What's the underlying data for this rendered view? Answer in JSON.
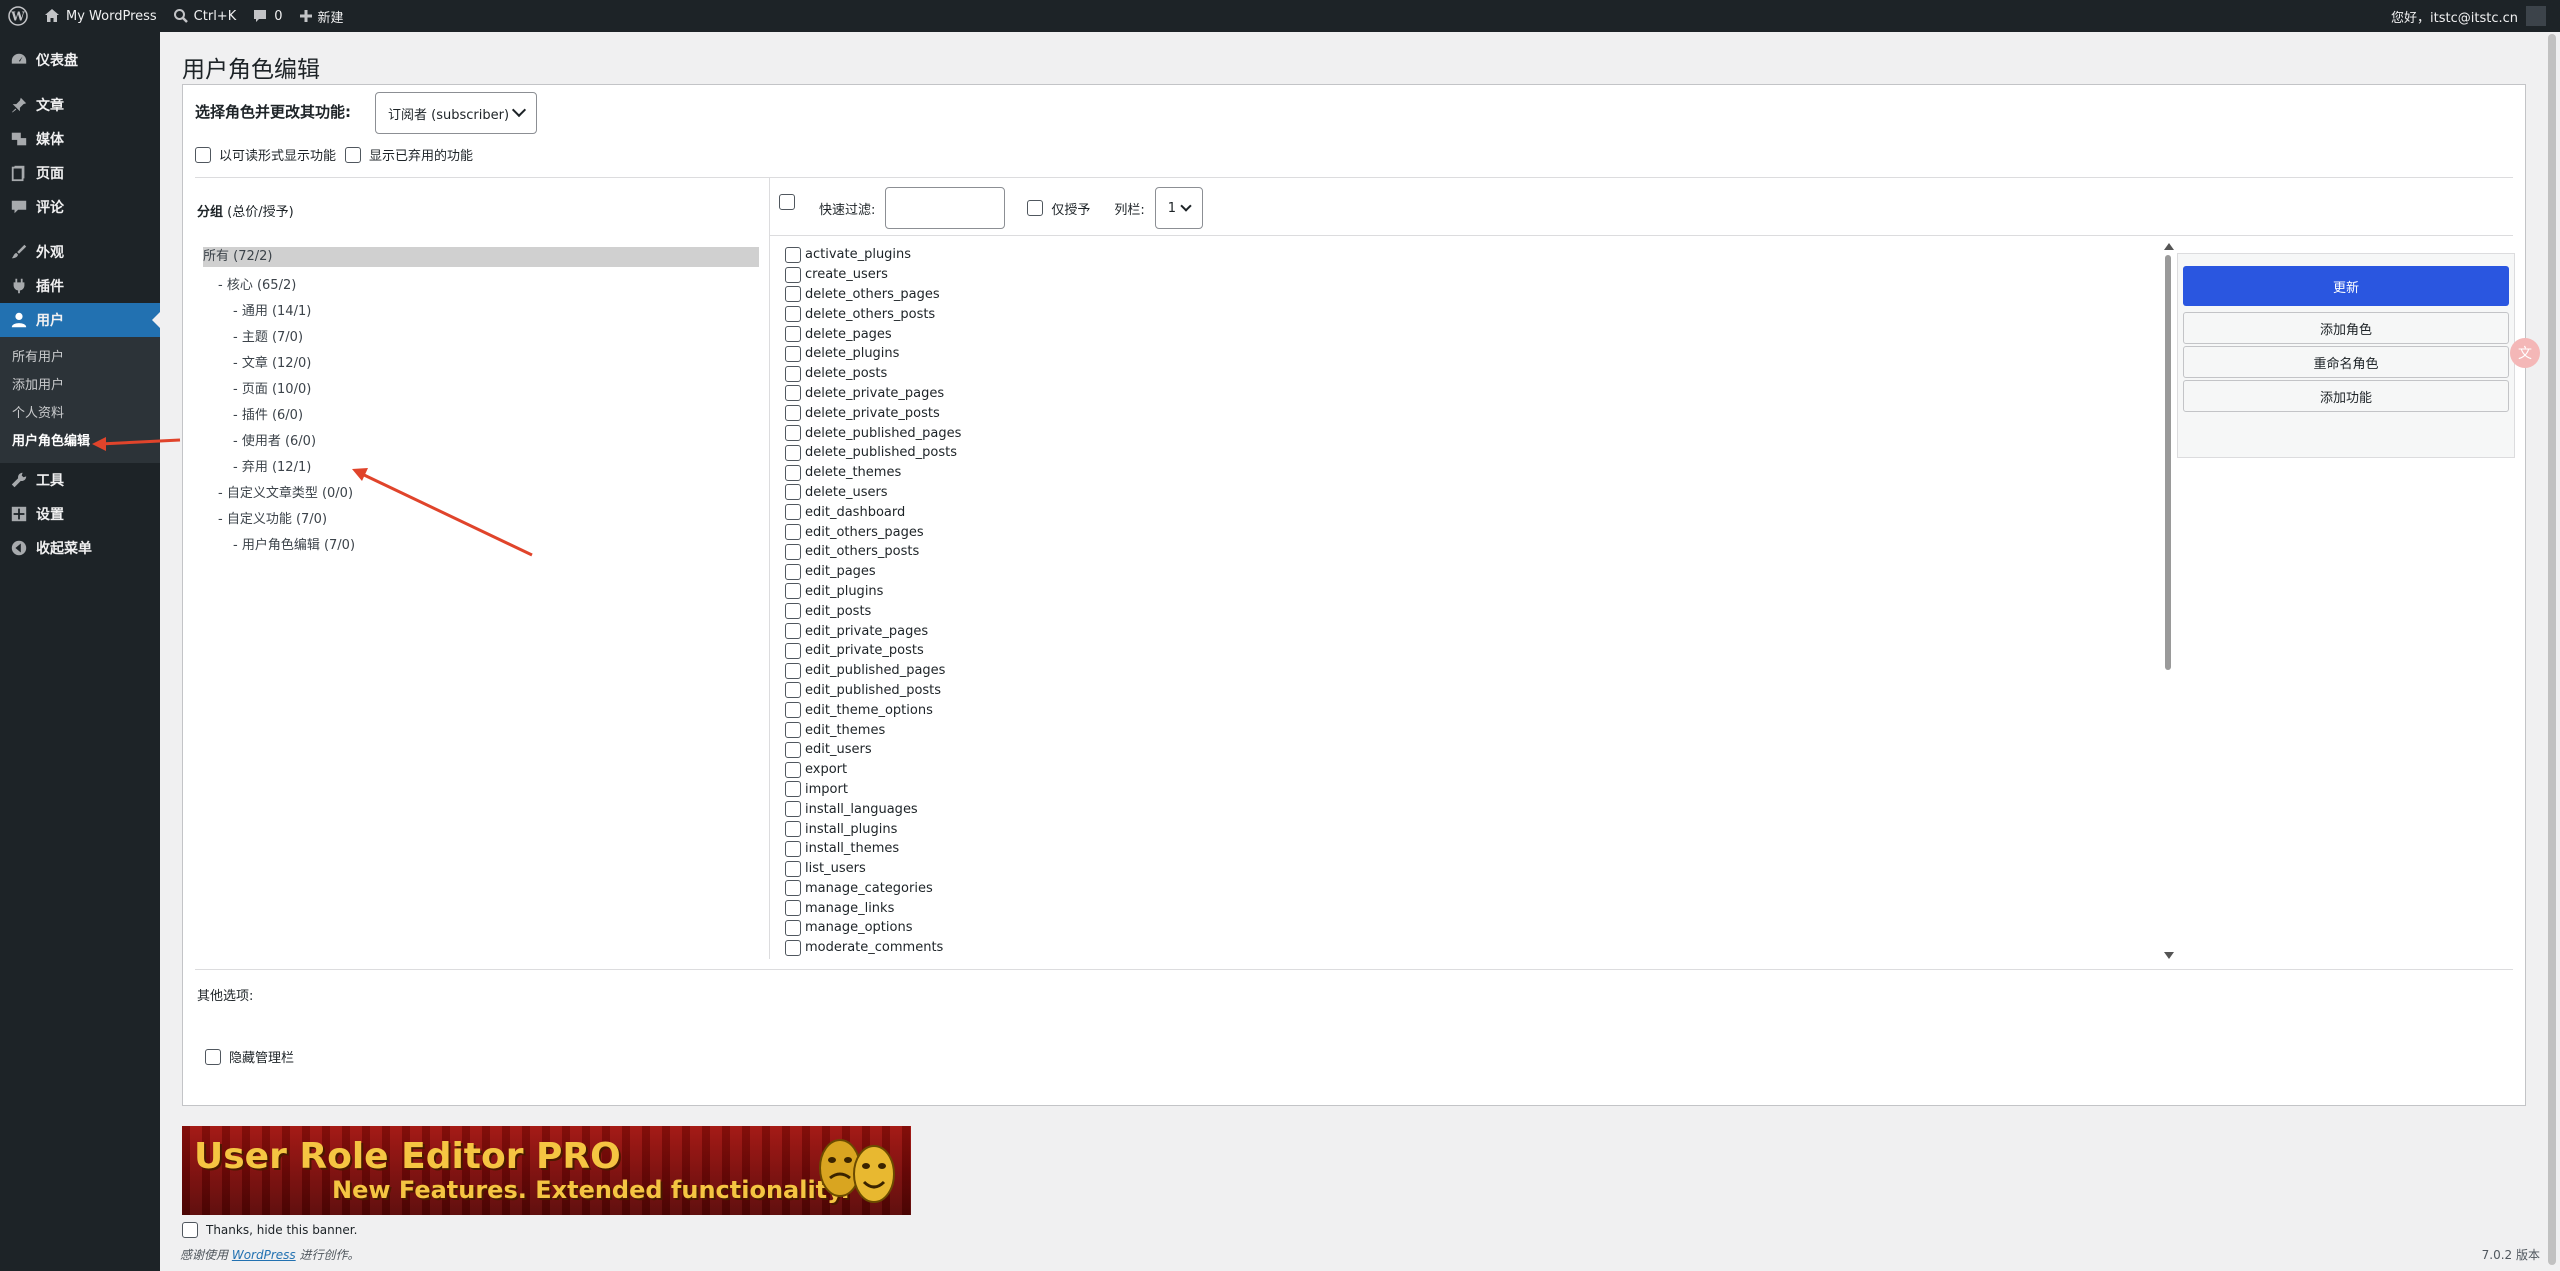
{
  "adminbar": {
    "site_name": "My WordPress",
    "search_shortcut": "Ctrl+K",
    "comments_count": "0",
    "new_label": "新建",
    "greeting": "您好，itstc@itstc.cn"
  },
  "sidebar": {
    "items": [
      {
        "label": "仪表盘",
        "icon": "dashboard-icon"
      },
      {
        "label": "文章",
        "icon": "pin-icon"
      },
      {
        "label": "媒体",
        "icon": "media-icon"
      },
      {
        "label": "页面",
        "icon": "page-icon"
      },
      {
        "label": "评论",
        "icon": "comment-icon"
      },
      {
        "label": "外观",
        "icon": "brush-icon"
      },
      {
        "label": "插件",
        "icon": "plugin-icon"
      },
      {
        "label": "用户",
        "icon": "user-icon"
      },
      {
        "label": "工具",
        "icon": "wrench-icon"
      },
      {
        "label": "设置",
        "icon": "settings-icon"
      },
      {
        "label": "收起菜单",
        "icon": "collapse-icon"
      }
    ],
    "submenu": [
      "所有用户",
      "添加用户",
      "个人资料",
      "用户角色编辑"
    ]
  },
  "page": {
    "title": "用户角色编辑",
    "role_label": "选择角色并更改其功能:",
    "role_value": "订阅者 (subscriber)",
    "opt_readable": "以可读形式显示功能",
    "opt_deprecated": "显示已弃用的功能",
    "groups_head_bold": "分组",
    "groups_head_rest": " (总价/授予)",
    "quick_filter": "快速过滤:",
    "granted_only": "仅授予",
    "columns_label": "列栏:",
    "columns_value": "1",
    "other_options": "其他选项:",
    "hide_admin_bar": "隐藏管理栏"
  },
  "tree": [
    {
      "label": "所有 (72/2)",
      "indent": 0
    },
    {
      "label": "- 核心 (65/2)",
      "indent": 1
    },
    {
      "label": "- 通用 (14/1)",
      "indent": 2
    },
    {
      "label": "- 主题 (7/0)",
      "indent": 2
    },
    {
      "label": "- 文章 (12/0)",
      "indent": 2
    },
    {
      "label": "- 页面 (10/0)",
      "indent": 2
    },
    {
      "label": "- 插件 (6/0)",
      "indent": 2
    },
    {
      "label": "- 使用者 (6/0)",
      "indent": 2
    },
    {
      "label": "- 弃用 (12/1)",
      "indent": 2
    },
    {
      "label": "- 自定义文章类型 (0/0)",
      "indent": 1
    },
    {
      "label": "- 自定义功能 (7/0)",
      "indent": 1
    },
    {
      "label": "- 用户角色编辑 (7/0)",
      "indent": 2
    }
  ],
  "capabilities": [
    "activate_plugins",
    "create_users",
    "delete_others_pages",
    "delete_others_posts",
    "delete_pages",
    "delete_plugins",
    "delete_posts",
    "delete_private_pages",
    "delete_private_posts",
    "delete_published_pages",
    "delete_published_posts",
    "delete_themes",
    "delete_users",
    "edit_dashboard",
    "edit_others_pages",
    "edit_others_posts",
    "edit_pages",
    "edit_plugins",
    "edit_posts",
    "edit_private_pages",
    "edit_private_posts",
    "edit_published_pages",
    "edit_published_posts",
    "edit_theme_options",
    "edit_themes",
    "edit_users",
    "export",
    "import",
    "install_languages",
    "install_plugins",
    "install_themes",
    "list_users",
    "manage_categories",
    "manage_links",
    "manage_options",
    "moderate_comments"
  ],
  "actions": {
    "update": "更新",
    "add_role": "添加角色",
    "rename_role": "重命名角色",
    "add_capability": "添加功能"
  },
  "banner": {
    "title": "User Role Editor PRO",
    "subtitle": "New Features. Extended functionality.",
    "hide_label": "Thanks, hide this banner."
  },
  "footer": {
    "prefix": "感谢使用",
    "link": "WordPress",
    "suffix": "进行创作。",
    "version": "7.0.2 版本"
  },
  "colors": {
    "accent": "#2271b1",
    "primary_button": "#2a56e0",
    "annotation": "#e0442b"
  }
}
